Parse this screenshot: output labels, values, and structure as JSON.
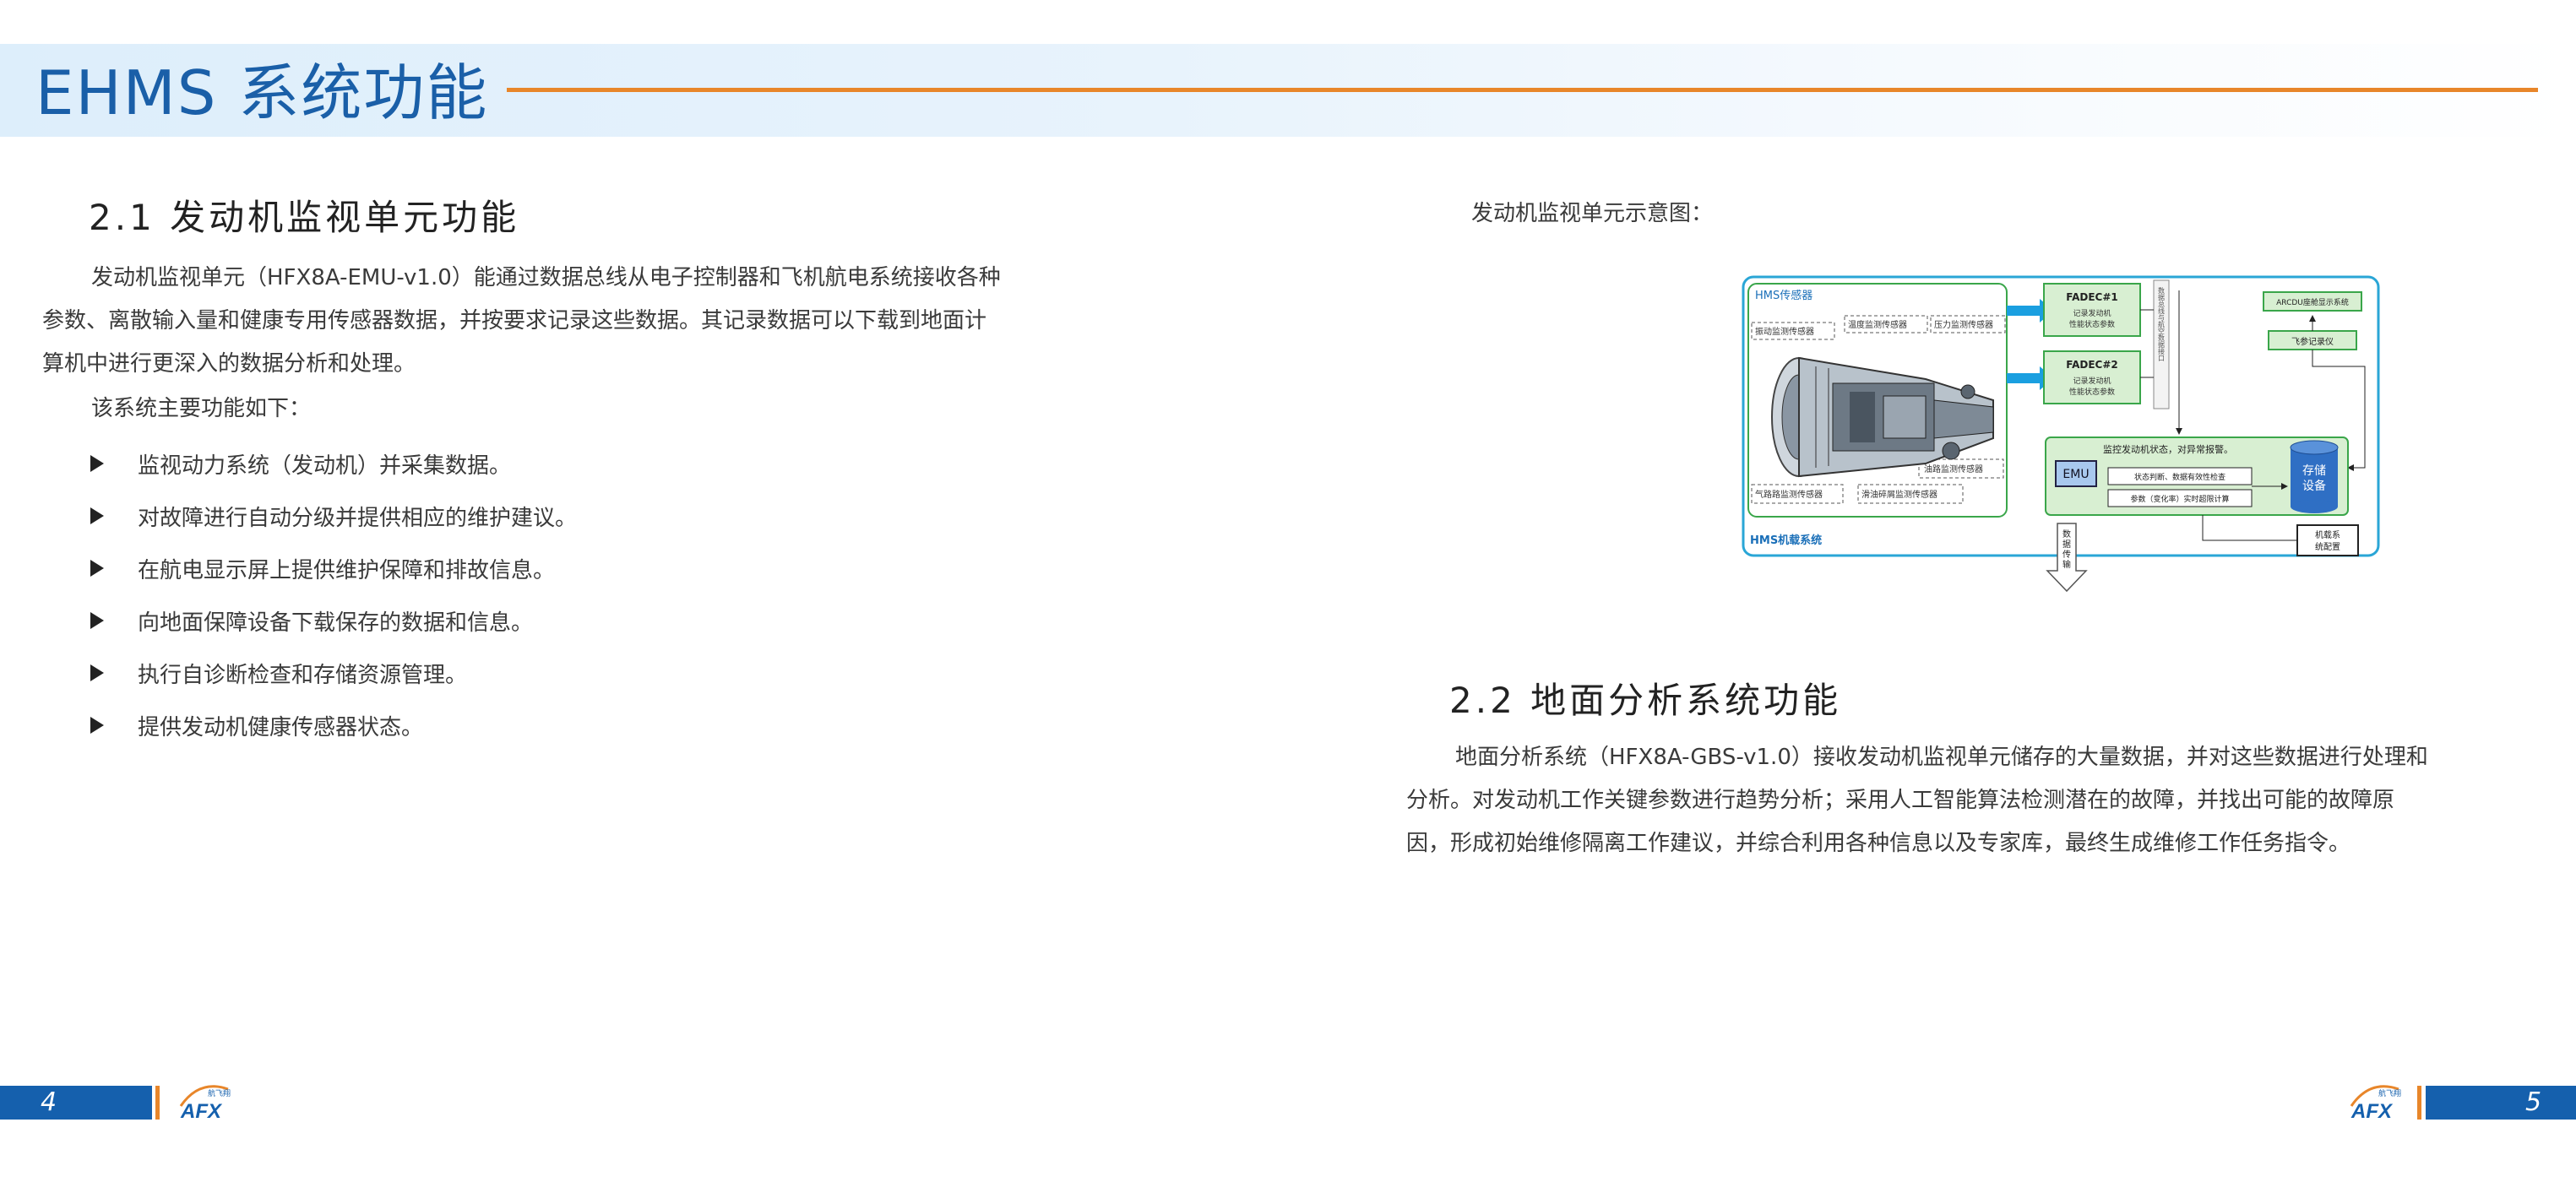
{
  "header": {
    "title": "EHMS 系统功能"
  },
  "left": {
    "heading": "2.1  发动机监视单元功能",
    "paragraph_lines": [
      "发动机监视单元（HFX8A-EMU-v1.0）能通过数据总线从电子控制器和飞机航电系统接收各种",
      "参数、离散输入量和健康专用传感器数据，并按要求记录这些数据。其记录数据可以下载到地面计",
      "算机中进行更深入的数据分析和处理。"
    ],
    "intro": "该系统主要功能如下：",
    "bullets": [
      "监视动力系统（发动机）并采集数据。",
      "对故障进行自动分级并提供相应的维护建议。",
      "在航电显示屏上提供维护保障和排故信息。",
      "向地面保障设备下载保存的数据和信息。",
      "执行自诊断检查和存储资源管理。",
      "提供发动机健康传感器状态。"
    ]
  },
  "right": {
    "caption": "发动机监视单元示意图：",
    "heading": "2.2  地面分析系统功能",
    "paragraph_lines": [
      "地面分析系统（HFX8A-GBS-v1.0）接收发动机监视单元储存的大量数据，并对这些数据进行处理和",
      "分析。对发动机工作关键参数进行趋势分析；采用人工智能算法检测潜在的故障，并找出可能的故障原",
      "因，形成初始维修隔离工作建议，并综合利用各种信息以及专家库，最终生成维修工作任务指令。"
    ]
  },
  "diagram": {
    "hms_sensor_label": "HMS传感器",
    "hms_onboard_label": "HMS机载系统",
    "sensors": [
      "振动监测传感器",
      "温度监测传感器",
      "压力监测传感器",
      "油路监测传感器",
      "气路路监测传感器",
      "滑油碎屑监测传感器"
    ],
    "fadec1_title": "FADEC#1",
    "fadec1_sub1": "记录发动机",
    "fadec1_sub2": "性能状态参数",
    "fadec2_title": "FADEC#2",
    "fadec2_sub1": "记录发动机",
    "fadec2_sub2": "性能状态参数",
    "bus_label": "数据总线与航空数据接口",
    "display_system": "ARCDU座舱显示系统",
    "flight_recorder": "飞参记录仪",
    "emu_title": "监控发动机状态，对异常报警。",
    "emu_label": "EMU",
    "emu_task1": "状态判断、数据有效性检查",
    "emu_task2": "参数（变化率）实时超限计算",
    "storage_label_1": "存储",
    "storage_label_2": "设备",
    "ground_1": "机载系",
    "ground_2": "统配置",
    "transfer_1": "数",
    "transfer_2": "据",
    "transfer_3": "传",
    "transfer_4": "输"
  },
  "footer": {
    "left_page": "4",
    "right_page": "5",
    "logo_text": "AFX",
    "logo_small": "航飞翔"
  },
  "colors": {
    "title_blue": "#1a5fa8",
    "accent_orange": "#e8862a",
    "footer_blue": "#1560ad",
    "diagram_frame": "#2aa6d6",
    "diagram_green": "#3aa64a"
  }
}
